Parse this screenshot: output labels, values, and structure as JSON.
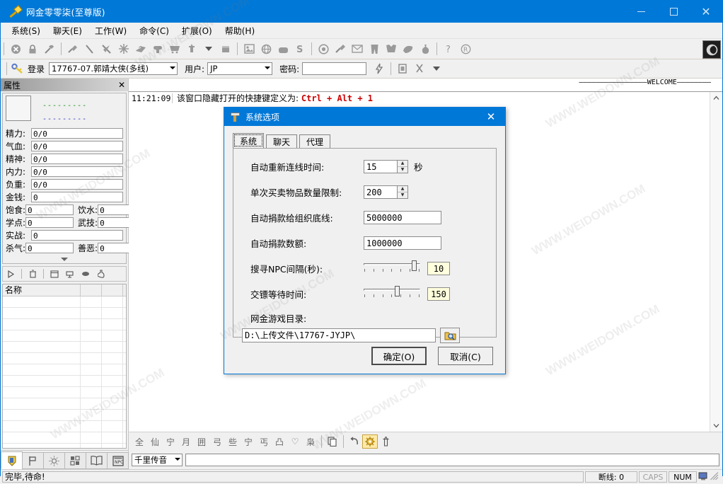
{
  "window": {
    "title": "网金零零柒(至尊版)",
    "icon": "hammer-icon",
    "minimize": "—",
    "maximize": "▢",
    "close": "✕"
  },
  "menubar": {
    "items": [
      {
        "label": "系统(S)",
        "name": "menu-system"
      },
      {
        "label": "聊天(E)",
        "name": "menu-chat"
      },
      {
        "label": "工作(W)",
        "name": "menu-work"
      },
      {
        "label": "命令(C)",
        "name": "menu-command"
      },
      {
        "label": "扩展(O)",
        "name": "menu-extend"
      },
      {
        "label": "帮助(H)",
        "name": "menu-help"
      }
    ]
  },
  "toolbar": {
    "icons": [
      "disconnect-icon",
      "lock-icon",
      "hammer-icon",
      "sep",
      "axe-icon",
      "rod-icon",
      "pickaxe-icon",
      "star-icon",
      "book-icon",
      "plug-icon",
      "cart-icon",
      "sword-icon",
      "dropdown-arrow-icon",
      "box-icon",
      "sep",
      "picture-icon",
      "globe-icon",
      "bag-icon",
      "s-icon",
      "sep",
      "target-icon",
      "hammer2-icon",
      "mail-icon",
      "pants-icon",
      "shirt-icon",
      "stone-icon",
      "pouch-icon",
      "sep",
      "help-icon",
      "register-icon"
    ],
    "right_badge": "moon-logo-icon"
  },
  "loginbar": {
    "key_icon": "key-icon",
    "login_label": "登录",
    "server_value": "17767-07.郭靖大侠(多线)",
    "user_label": "用户:",
    "user_value": "JP",
    "password_label": "密码:",
    "password_value": "",
    "lightning_icon": "lightning-icon",
    "extra_icons": [
      "stamp-icon",
      "scissors-icon",
      "dropdown-arrow-icon"
    ]
  },
  "left_panel": {
    "title": "属性",
    "close": "✕",
    "dash_green": "---------",
    "dash_blue": "---------",
    "attributes": [
      {
        "label": "精力:",
        "value": "0/0",
        "label2": null,
        "value2": null
      },
      {
        "label": "气血:",
        "value": "0/0",
        "label2": null,
        "value2": null
      },
      {
        "label": "精神:",
        "value": "0/0",
        "label2": null,
        "value2": null
      },
      {
        "label": "内力:",
        "value": "0/0",
        "label2": null,
        "value2": null
      },
      {
        "label": "负重:",
        "value": "0/0",
        "label2": null,
        "value2": null
      },
      {
        "label": "金钱:",
        "value": "0",
        "label2": null,
        "value2": null
      },
      {
        "label": "饱食:",
        "value": "0",
        "label2": "饮水:",
        "value2": "0"
      },
      {
        "label": "学点:",
        "value": "0",
        "label2": "武技:",
        "value2": "0"
      },
      {
        "label": "实战:",
        "value": "0",
        "label2": null,
        "value2": null
      },
      {
        "label": "杀气:",
        "value": "0",
        "label2": "善恶:",
        "value2": "0"
      }
    ],
    "mini_toolbar": [
      "play-icon",
      "sep",
      "trash-icon",
      "sep",
      "window-icon",
      "import-icon",
      "pill-icon",
      "bottle-icon"
    ],
    "list": {
      "columns": [
        "名称",
        "",
        ""
      ],
      "rows": []
    },
    "tabs": [
      "shield-icon",
      "flag-icon",
      "sun-icon",
      "grid-icon",
      "book-icon",
      "npc-icon"
    ]
  },
  "center": {
    "welcome_banner": "————————————————WELCOME————————",
    "log": [
      {
        "time": "11:21:09",
        "text": "该窗口隐藏打开的快捷键定义为:",
        "hotkey": "Ctrl + Alt + 1"
      }
    ],
    "bottom_toolbar_glyphs": [
      "全",
      "仙",
      "宁",
      "月",
      "囲",
      "弓",
      "些",
      "宁",
      "丐",
      "凸",
      "♡",
      "枭"
    ],
    "bottom_toolbar_icons": [
      "copy-icon",
      "undo-icon",
      "gear-icon",
      "sword-icon"
    ],
    "chat_mode": "千里传音",
    "chat_input": "",
    "scrollbar": {
      "up": "⌃",
      "down": "⌄"
    }
  },
  "statusbar": {
    "message": "完毕,待命!",
    "disconnect": "断线: 0",
    "caps": "CAPS",
    "num": "NUM",
    "computer_icon": "computer-icon"
  },
  "dialog": {
    "title": "系统选项",
    "icon": "hammer-icon",
    "close": "✕",
    "tabs": [
      {
        "label": "系统",
        "selected": true
      },
      {
        "label": "聊天",
        "selected": false
      },
      {
        "label": "代理",
        "selected": false
      }
    ],
    "fields": [
      {
        "label": "自动重新连线时间:",
        "type": "spin",
        "value": "15",
        "unit": "秒"
      },
      {
        "label": "单次买卖物品数量限制:",
        "type": "spin",
        "value": "200",
        "unit": ""
      },
      {
        "label": "自动捐款给组织底线:",
        "type": "text",
        "value": "5000000"
      },
      {
        "label": "自动捐款数额:",
        "type": "text",
        "value": "1000000"
      },
      {
        "label": "搜寻NPC间隔(秒):",
        "type": "slider",
        "value": "10",
        "percent": 92
      },
      {
        "label": "交镖等待时间:",
        "type": "slider",
        "value": "150",
        "percent": 62
      }
    ],
    "path_label": "网金游戏目录:",
    "path_value": "D:\\上传文件\\17767-JYJP\\",
    "browse_icon": "folder-search-icon",
    "ok_label": "确定(O)",
    "cancel_label": "取消(C)"
  },
  "watermarks": [
    "WWW.WEIDOWN.COM",
    "WWW.WEIDOWN.COM",
    "WWW.WEIDOWN.COM",
    "WWW.WEIDOWN.COM",
    "WWW.WEIDOWN.COM",
    "WWW.WEIDOWN.COM",
    "WWW.WEIDOWN.COM",
    "WWW.WEIDOWN.COM"
  ],
  "colors": {
    "accent": "#0078d7",
    "face": "#f0f0f0",
    "hotkey": "#cc0000",
    "slider_value_bg": "#ffffdd"
  }
}
